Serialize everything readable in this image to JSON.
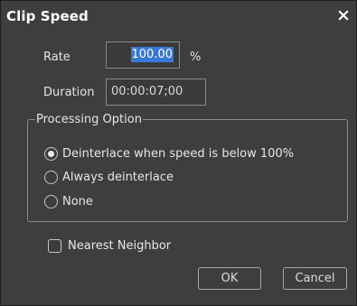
{
  "window": {
    "title": "Clip Speed",
    "close_icon": "close-icon"
  },
  "rate": {
    "label": "Rate",
    "value": "100.00",
    "unit": "%",
    "selected": true,
    "highlight_color": "#3878d8"
  },
  "duration": {
    "label": "Duration",
    "value": "00:00:07;00"
  },
  "processing": {
    "legend": "Processing Option",
    "options": [
      {
        "label": "Deinterlace when speed is below 100%",
        "checked": true
      },
      {
        "label": "Always deinterlace",
        "checked": false
      },
      {
        "label": "None",
        "checked": false
      }
    ]
  },
  "nearest_neighbor": {
    "label": "Nearest Neighbor",
    "checked": false
  },
  "buttons": {
    "ok": "OK",
    "cancel": "Cancel"
  },
  "colors": {
    "background": "#3e3e3e",
    "text": "#e6e6e6",
    "border": "#8c8c8c"
  }
}
